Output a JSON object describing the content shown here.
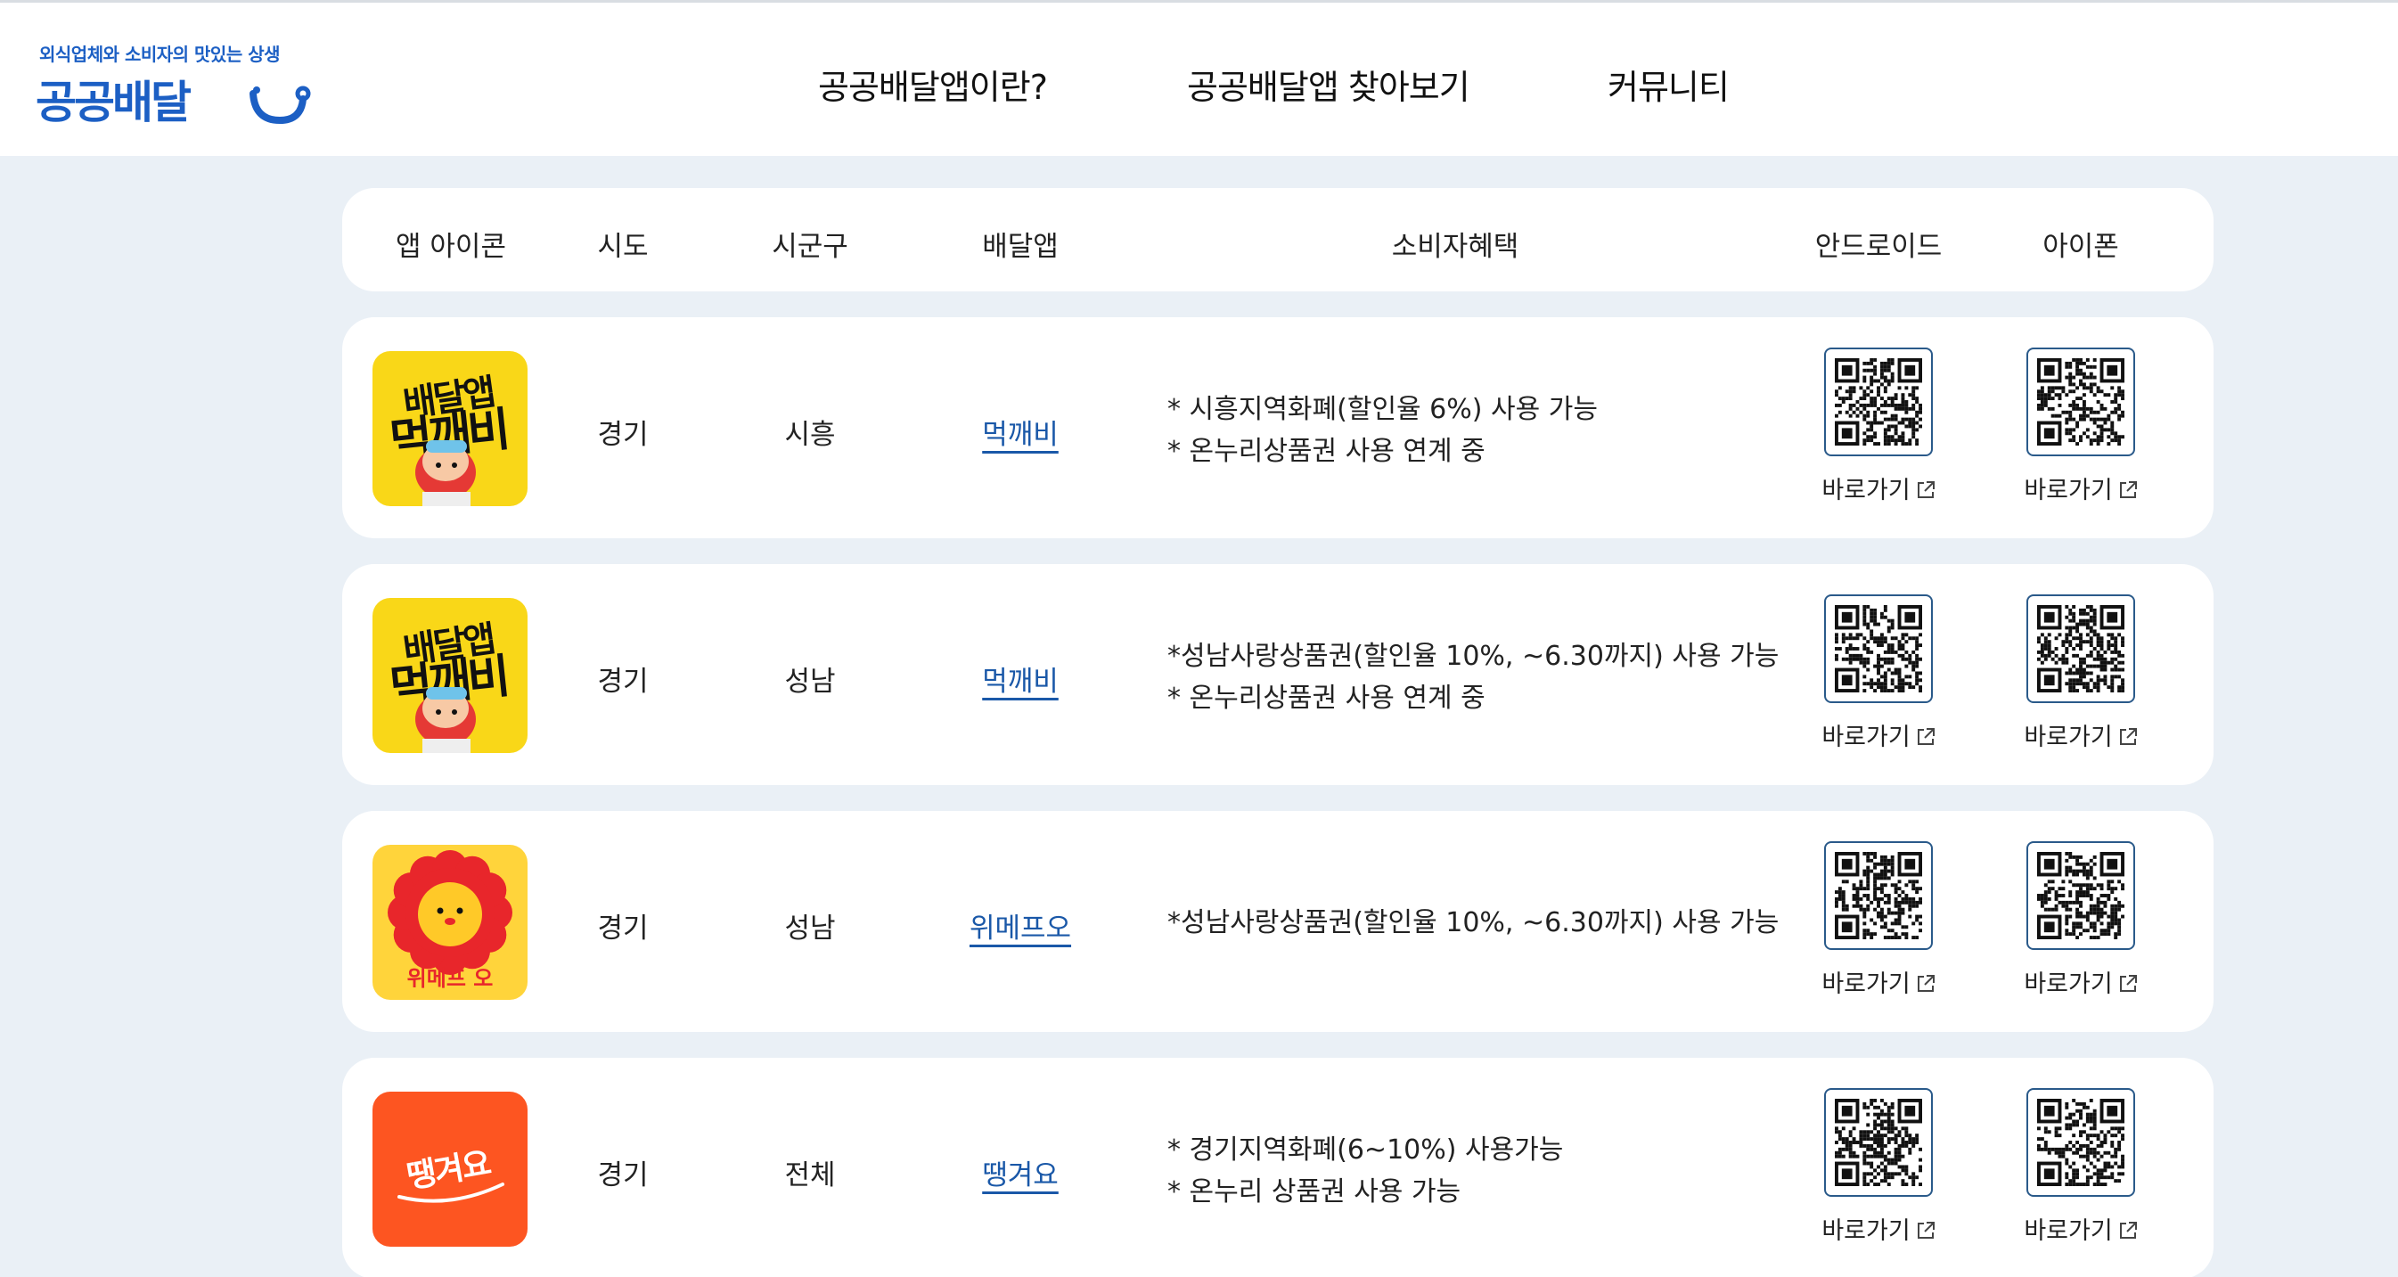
{
  "header": {
    "logo_tagline": "외식업체와 소비자의 맛있는 상생",
    "logo_title": "공공배달",
    "nav": [
      "공공배달앱이란?",
      "공공배달앱 찾아보기",
      "커뮤니티"
    ]
  },
  "table": {
    "columns": [
      "앱 아이콘",
      "시도",
      "시군구",
      "배달앱",
      "소비자혜택",
      "안드로이드",
      "아이폰"
    ],
    "goto_label": "바로가기",
    "rows": [
      {
        "icon": "meokkaebi-app-icon",
        "sido": "경기",
        "sigungu": "시흥",
        "app": "먹깨비",
        "benefits": [
          "* 시흥지역화폐(할인율 6%) 사용 가능",
          "* 온누리상품권 사용 연계 중"
        ]
      },
      {
        "icon": "meokkaebi-app-icon",
        "sido": "경기",
        "sigungu": "성남",
        "app": "먹깨비",
        "benefits": [
          "*성남사랑상품권(할인율 10%, ~6.30까지) 사용 가능",
          "* 온누리상품권 사용 연계 중"
        ]
      },
      {
        "icon": "wemakeprice-o-app-icon",
        "sido": "경기",
        "sigungu": "성남",
        "app": "위메프오",
        "benefits": [
          "*성남사랑상품권(할인율 10%, ~6.30까지) 사용 가능"
        ]
      },
      {
        "icon": "ttaenggyeoyo-app-icon",
        "sido": "경기",
        "sigungu": "전체",
        "app": "땡겨요",
        "benefits": [
          "* 경기지역화폐(6~10%) 사용가능",
          "* 온누리 상품권 사용 가능"
        ]
      }
    ]
  },
  "icon_text": {
    "meokkaebi_top": "배달앱",
    "meokkaebi_bottom": "먹깨비",
    "wemakeprice": "위메프 오",
    "ttaenggyeoyo": "땡겨요"
  },
  "colors": {
    "brand_blue": "#1c5fc4",
    "link_blue": "#1a58a8",
    "page_bg": "#eaf0f6",
    "meokkaebi_yellow": "#f9d718",
    "wemakeprice_yellow": "#ffd43b",
    "ttaenggyeoyo_orange": "#fd5521"
  }
}
